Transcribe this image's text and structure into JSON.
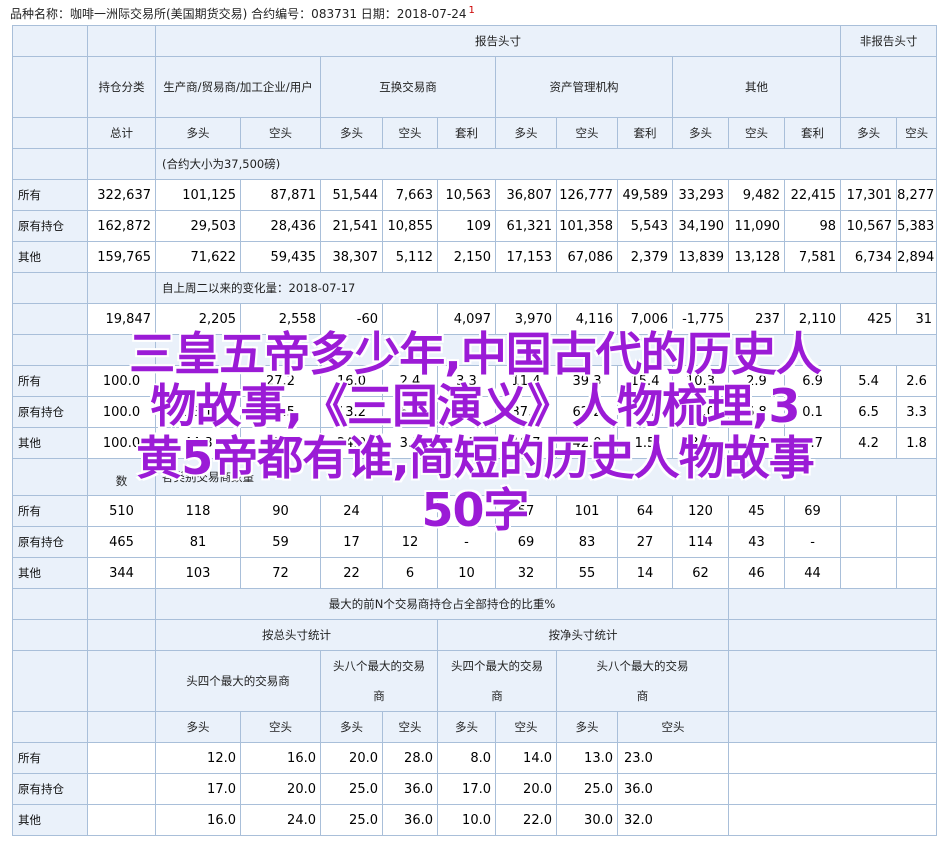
{
  "header": {
    "text": "品种名称：咖啡一洲际交易所(美国期货交易)   合约编号：083731   日期：2018-07-24",
    "sup": "1"
  },
  "headers": {
    "report": "报告头寸",
    "nonreport": "非报告头寸",
    "class": "持仓分类",
    "producer": "生产商/贸易商/加工企业/用户",
    "swap": "互换交易商",
    "asset": "资产管理机构",
    "other": "其他",
    "total": "总计",
    "long": "多头",
    "short": "空头",
    "spread": "套利"
  },
  "rows_label": {
    "all": "所有",
    "old": "原有持仓",
    "other": "其他"
  },
  "section1": {
    "note": "(合约大小为37,500磅)",
    "rows": [
      [
        "322,637",
        "101,125",
        "87,871",
        "51,544",
        "7,663",
        "10,563",
        "36,807",
        "126,777",
        "49,589",
        "33,293",
        "9,482",
        "22,415",
        "17,301",
        "8,277"
      ],
      [
        "162,872",
        "29,503",
        "28,436",
        "21,541",
        "10,855",
        "109",
        "61,321",
        "101,358",
        "5,543",
        "34,190",
        "11,090",
        "98",
        "10,567",
        "5,383"
      ],
      [
        "159,765",
        "71,622",
        "59,435",
        "38,307",
        "5,112",
        "2,150",
        "17,153",
        "67,086",
        "2,379",
        "13,839",
        "13,128",
        "7,581",
        "6,734",
        "2,894"
      ]
    ]
  },
  "section2": {
    "note": "自上周二以来的变化量：2018-07-17",
    "row": [
      "19,847",
      "2,205",
      "2,558",
      "-60",
      "4,097",
      "3,970",
      "4,116",
      "7,006",
      "-1,775",
      "237",
      "2,110",
      "425",
      "31"
    ]
  },
  "section3": {
    "rows": [
      [
        "100.0",
        "",
        "27.2",
        "16.0",
        "2.4",
        "3.3",
        "11.4",
        "39.3",
        "15.4",
        "10.3",
        "2.9",
        "6.9",
        "5.4",
        "2.6"
      ],
      [
        "100.0",
        "18.1",
        "17.5",
        "13.2",
        "6.7",
        "0.1",
        "37.6",
        "62.2",
        "3.4",
        "21.0",
        "6.8",
        "0.1",
        "6.5",
        "3.3"
      ],
      [
        "100.0",
        "44.8",
        "37.2",
        "24.0",
        "3.2",
        "1.3",
        "10.7",
        "42.0",
        "1.5",
        "8.7",
        "8.2",
        "4.7",
        "4.2",
        "1.8"
      ]
    ]
  },
  "section4": {
    "note": "各类别交易商数量",
    "note_tail": "数",
    "rows": [
      [
        "510",
        "118",
        "90",
        "24",
        "",
        "",
        "57",
        "101",
        "64",
        "120",
        "45",
        "69"
      ],
      [
        "465",
        "81",
        "59",
        "17",
        "12",
        "-",
        "69",
        "83",
        "27",
        "114",
        "43",
        "-"
      ],
      [
        "344",
        "103",
        "72",
        "22",
        "6",
        "10",
        "32",
        "55",
        "14",
        "62",
        "46",
        "44"
      ]
    ]
  },
  "section5": {
    "title": "最大的前N个交易商持仓占全部持仓的比重%",
    "gross": "按总头寸统计",
    "net": "按净头寸统计",
    "top4": "头四个最大的交易商",
    "top8_a": "头八个最大的交易",
    "top8_b": "商",
    "top4_net_a": "头四个最大的交易",
    "top4_net_b": "商",
    "top8_net_a": "头八个最大的交易",
    "top8_net_b": "商",
    "rows": [
      [
        "12.0",
        "16.0",
        "20.0",
        "28.0",
        "8.0",
        "14.0",
        "13.0",
        "23.0"
      ],
      [
        "17.0",
        "20.0",
        "25.0",
        "36.0",
        "17.0",
        "20.0",
        "25.0",
        "36.0"
      ],
      [
        "16.0",
        "24.0",
        "25.0",
        "36.0",
        "10.0",
        "22.0",
        "30.0",
        "32.0"
      ]
    ]
  },
  "overlay": {
    "line1": "三皇五帝多少年,中国古代的历史人",
    "line2": "物故事,《三国演义》人物梳理,3",
    "line3": "黄5帝都有谁,简短的历史人物故事",
    "line4": "50字"
  }
}
